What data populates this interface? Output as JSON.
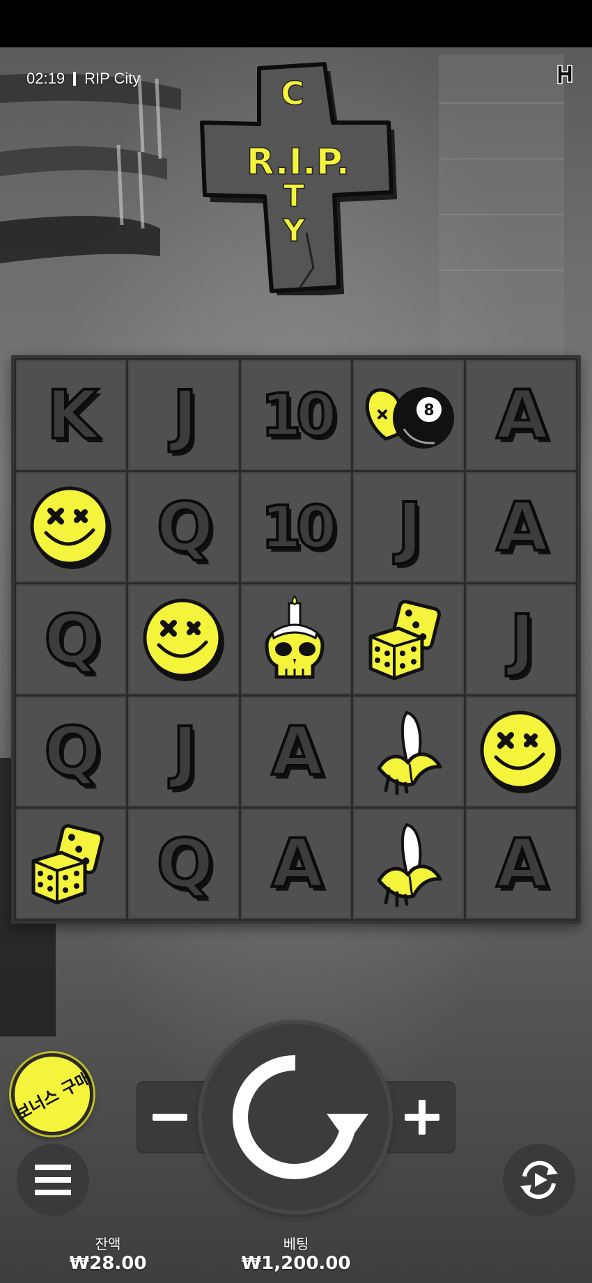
{
  "status": {
    "time": "02:19",
    "game_name": "RIP City"
  },
  "logo": {
    "word_horizontal": "R.I.P.",
    "word_vertical": [
      "C",
      "I",
      "T",
      "Y"
    ]
  },
  "colors": {
    "accent_yellow": "#f4f43c",
    "panel": "#3a3a3a",
    "cell": "#505050"
  },
  "grid": {
    "rows": [
      [
        {
          "type": "letter",
          "value": "K"
        },
        {
          "type": "letter",
          "value": "J"
        },
        {
          "type": "letter",
          "value": "10"
        },
        {
          "type": "symbol",
          "icon": "heart-eight-ball-icon"
        },
        {
          "type": "letter",
          "value": "A"
        }
      ],
      [
        {
          "type": "symbol",
          "icon": "smiley-icon"
        },
        {
          "type": "letter",
          "value": "Q"
        },
        {
          "type": "letter",
          "value": "10"
        },
        {
          "type": "letter",
          "value": "J"
        },
        {
          "type": "letter",
          "value": "A"
        }
      ],
      [
        {
          "type": "letter",
          "value": "Q"
        },
        {
          "type": "symbol",
          "icon": "smiley-icon"
        },
        {
          "type": "symbol",
          "icon": "skull-candle-icon"
        },
        {
          "type": "symbol",
          "icon": "dice-icon"
        },
        {
          "type": "letter",
          "value": "J"
        }
      ],
      [
        {
          "type": "letter",
          "value": "Q"
        },
        {
          "type": "letter",
          "value": "J"
        },
        {
          "type": "letter",
          "value": "A"
        },
        {
          "type": "symbol",
          "icon": "banana-icon"
        },
        {
          "type": "symbol",
          "icon": "smiley-icon"
        }
      ],
      [
        {
          "type": "symbol",
          "icon": "dice-icon"
        },
        {
          "type": "letter",
          "value": "Q"
        },
        {
          "type": "letter",
          "value": "A"
        },
        {
          "type": "symbol",
          "icon": "banana-icon"
        },
        {
          "type": "letter",
          "value": "A"
        }
      ]
    ]
  },
  "controls": {
    "bonus_buy_label": "보너스 구매",
    "minus_label": "−",
    "plus_label": "+"
  },
  "footer": {
    "balance_label": "잔액",
    "balance_value": "₩28.00",
    "bet_label": "베팅",
    "bet_value": "₩1,200.00"
  }
}
